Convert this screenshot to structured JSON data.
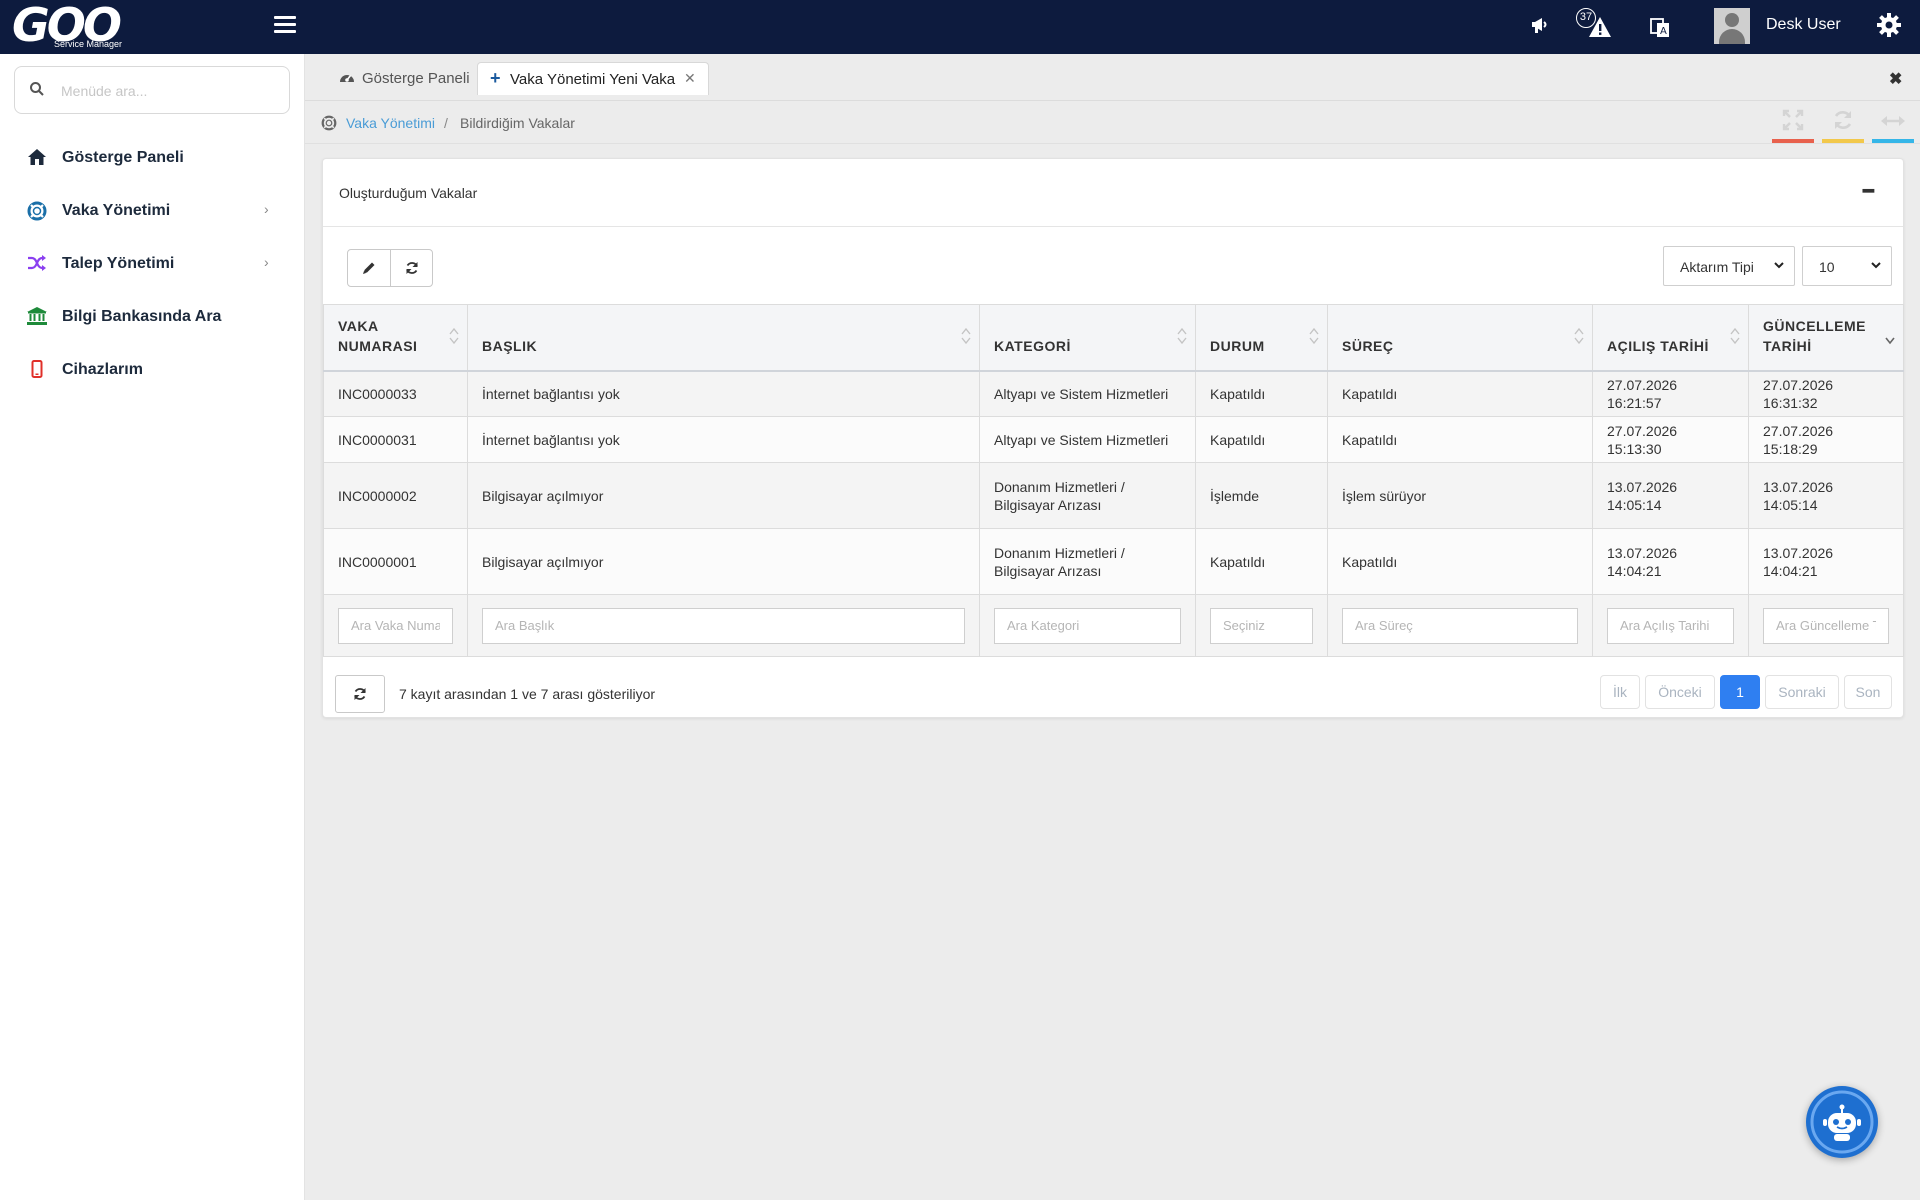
{
  "app": {
    "logo_text": "GOO",
    "logo_subtitle": "Service Manager"
  },
  "header": {
    "notification_count": "37",
    "user_name": "Desk User"
  },
  "sidebar": {
    "search_placeholder": "Menüde ara...",
    "items": [
      {
        "label": "Gösterge Paneli",
        "icon": "home-icon",
        "color": "#1d2a3c",
        "has_submenu": false
      },
      {
        "label": "Vaka Yönetimi",
        "icon": "lifebuoy-icon",
        "color": "#1a6fa8",
        "has_submenu": true
      },
      {
        "label": "Talep Yönetimi",
        "icon": "shuffle-icon",
        "color": "#8a3ff0",
        "has_submenu": true
      },
      {
        "label": "Bilgi Bankasında Ara",
        "icon": "bank-icon",
        "color": "#1e8a3a",
        "has_submenu": false
      },
      {
        "label": "Cihazlarım",
        "icon": "mobile-icon",
        "color": "#e0302a",
        "has_submenu": false
      }
    ]
  },
  "tabs": [
    {
      "label": "Gösterge Paneli",
      "active": false
    },
    {
      "label": "Vaka Yönetimi Yeni Vaka",
      "active": true
    }
  ],
  "breadcrumb": {
    "link": "Vaka Yönetimi",
    "separator": "/",
    "current": "Bildirdiğim Vakalar"
  },
  "toolbar_colors": [
    "#e8614d",
    "#f2c84b",
    "#35b6e8"
  ],
  "panel": {
    "title": "Oluşturduğum Vakalar",
    "export_select": "Aktarım Tipi",
    "page_size_select": "10"
  },
  "table": {
    "columns": [
      "VAKA NUMARASI",
      "BAŞLIK",
      "KATEGORİ",
      "DURUM",
      "SÜREÇ",
      "AÇILIŞ TARİHİ",
      "GÜNCELLEME TARİHİ"
    ],
    "rows": [
      [
        "INC0000033",
        "İnternet bağlantısı yok",
        "Altyapı ve Sistem Hizmetleri",
        "Kapatıldı",
        "Kapatıldı",
        "27.07.2026 16:21:57",
        "27.07.2026 16:31:32"
      ],
      [
        "INC0000031",
        "İnternet bağlantısı yok",
        "Altyapı ve Sistem Hizmetleri",
        "Kapatıldı",
        "Kapatıldı",
        "27.07.2026 15:13:30",
        "27.07.2026 15:18:29"
      ],
      [
        "INC0000002",
        "Bilgisayar açılmıyor",
        "Donanım Hizmetleri / Bilgisayar Arızası",
        "İşlemde",
        "İşlem sürüyor",
        "13.07.2026 14:05:14",
        "13.07.2026 14:05:14"
      ],
      [
        "INC0000001",
        "Bilgisayar açılmıyor",
        "Donanım Hizmetleri / Bilgisayar Arızası",
        "Kapatıldı",
        "Kapatıldı",
        "13.07.2026 14:04:21",
        "13.07.2026 14:04:21"
      ]
    ],
    "filters": [
      "Ara Vaka Numarası",
      "Ara Başlık",
      "Ara Kategori",
      "Seçiniz",
      "Ara Süreç",
      "Ara Açılış Tarihi",
      "Ara Güncelleme Tarihi"
    ]
  },
  "footer": {
    "info": "7 kayıt arasından 1 ve 7 arası gösteriliyor",
    "pager": {
      "first": "İlk",
      "prev": "Önceki",
      "current": "1",
      "next": "Sonraki",
      "last": "Son"
    }
  }
}
